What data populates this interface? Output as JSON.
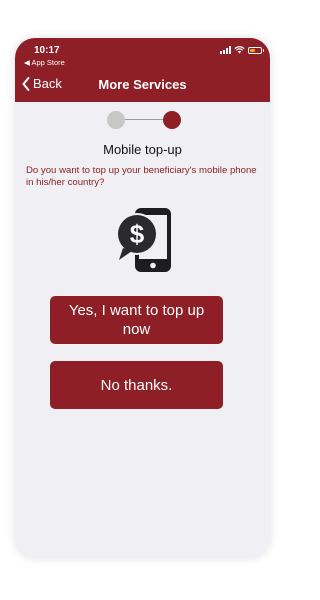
{
  "status_bar": {
    "time": "10:17",
    "back_app": "◀ App Store"
  },
  "nav": {
    "back_label": "Back",
    "title": "More Services"
  },
  "stepper": {
    "steps": 2,
    "current_step": 2
  },
  "content": {
    "heading": "Mobile top-up",
    "question": "Do you want to top up your beneficiary's mobile phone in his/her country?",
    "illustration_icon": "phone-dollar-icon"
  },
  "actions": {
    "yes_label": "Yes, I want to top up now",
    "no_label": "No thanks."
  },
  "colors": {
    "brand": "#8f1f27",
    "background": "#f0eff3",
    "step_inactive": "#c8c8c8",
    "battery": "#f2a61d"
  }
}
